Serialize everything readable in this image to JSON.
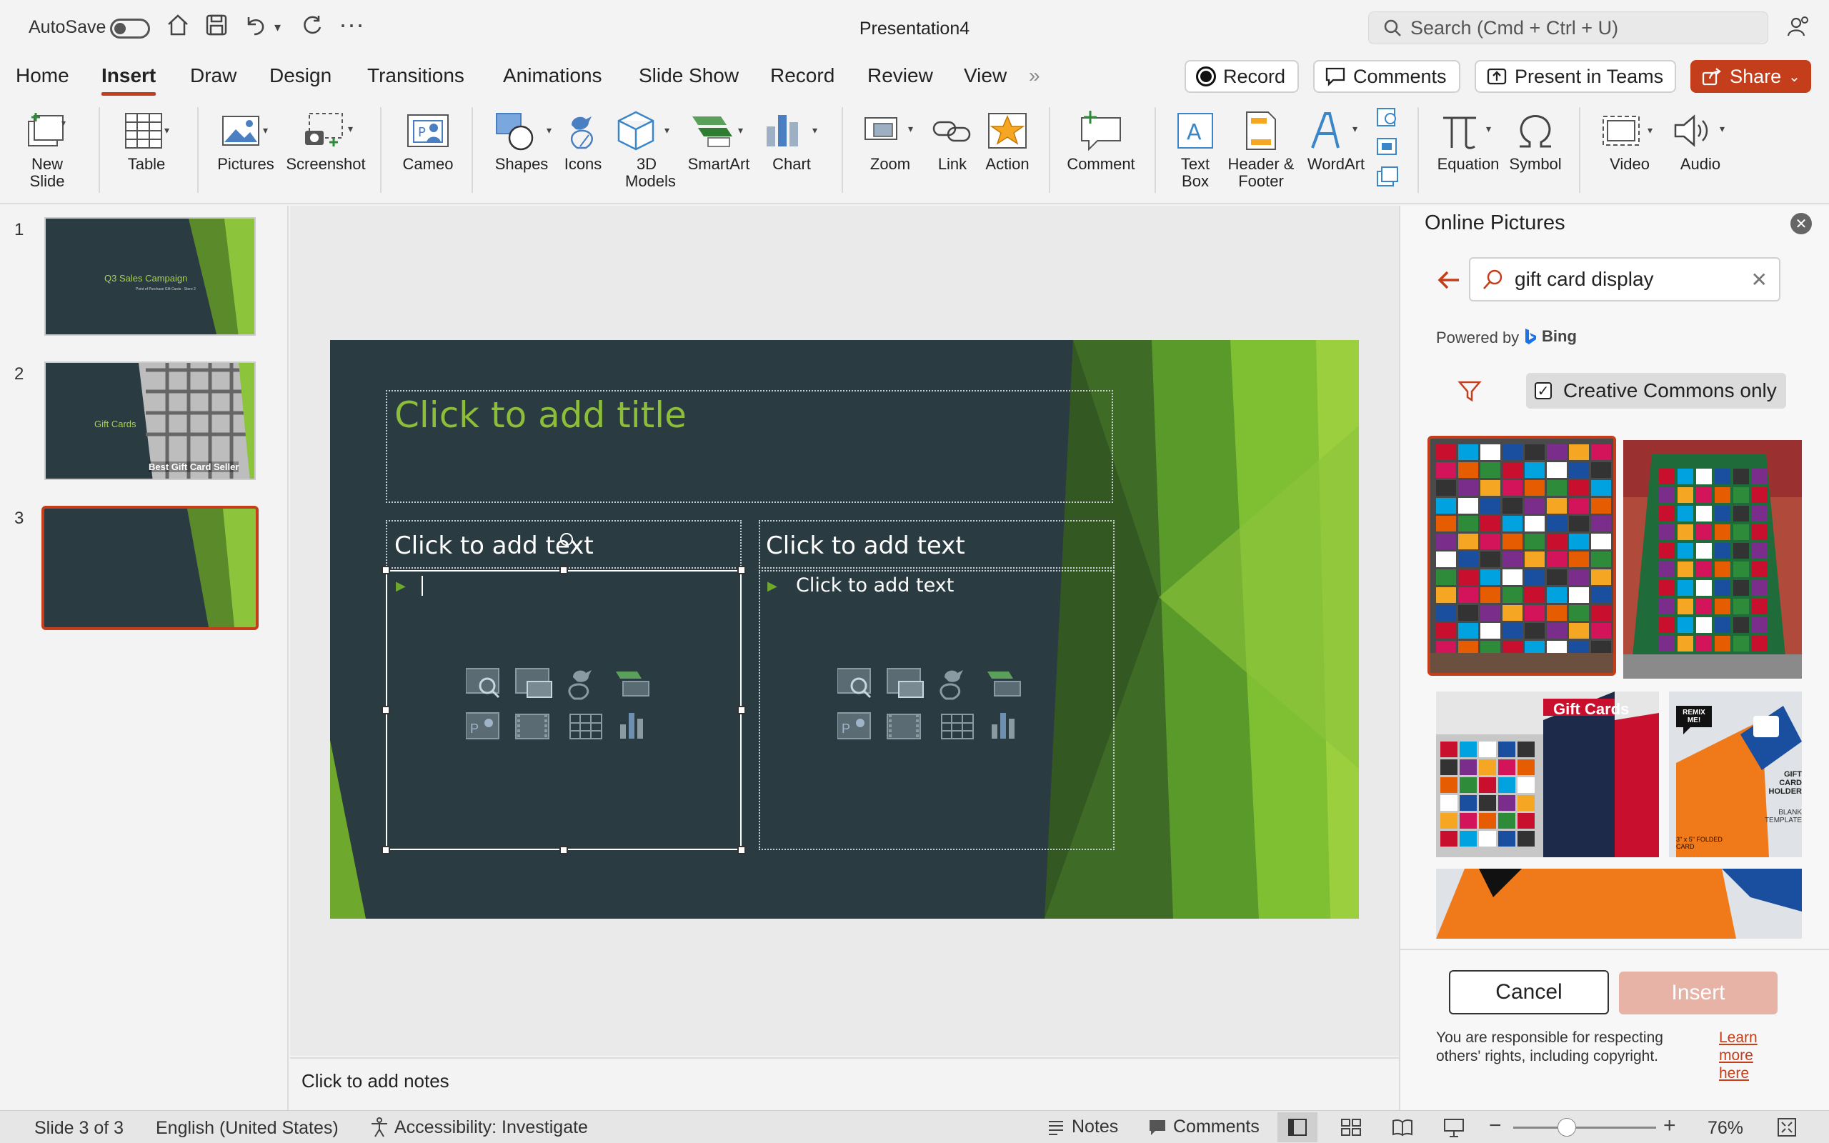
{
  "titlebar": {
    "autosave_label": "AutoSave",
    "doc_title": "Presentation4",
    "search_placeholder": "Search (Cmd + Ctrl + U)"
  },
  "menu": {
    "tabs": [
      "Home",
      "Insert",
      "Draw",
      "Design",
      "Transitions",
      "Animations",
      "Slide Show",
      "Record",
      "Review",
      "View"
    ],
    "active_tab": "Insert",
    "record_label": "Record",
    "comments_label": "Comments",
    "teams_label": "Present in Teams",
    "share_label": "Share"
  },
  "ribbon": {
    "new_slide": "New Slide",
    "table": "Table",
    "pictures": "Pictures",
    "screenshot": "Screenshot",
    "cameo": "Cameo",
    "shapes": "Shapes",
    "icons": "Icons",
    "models": "3D Models",
    "smartart": "SmartArt",
    "chart": "Chart",
    "zoom": "Zoom",
    "link": "Link",
    "action": "Action",
    "comment": "Comment",
    "textbox": "Text Box",
    "header_footer": "Header & Footer",
    "wordart": "WordArt",
    "equation": "Equation",
    "symbol": "Symbol",
    "video": "Video",
    "audio": "Audio"
  },
  "thumbnails": [
    {
      "num": "1",
      "title": "Q3 Sales Campaign",
      "subtitle": "Point of Purchase Gift Cards · Store 2"
    },
    {
      "num": "2",
      "title": "Gift Cards",
      "caption": "Best Gift Card Seller"
    },
    {
      "num": "3"
    }
  ],
  "slide": {
    "title_placeholder": "Click to add title",
    "left_header": "Click to add text",
    "right_header": "Click to add text",
    "right_bullet": "Click to add text"
  },
  "notes_placeholder": "Click to add notes",
  "pane": {
    "title": "Online Pictures",
    "search_value": "gift card display",
    "powered_by": "Powered by",
    "bing": "Bing",
    "cc_label": "Creative Commons only",
    "cc_checked": true,
    "cancel_label": "Cancel",
    "insert_label": "Insert",
    "disclaimer": "You are responsible for respecting others' rights, including copyright.",
    "learn_more": "Learn more here",
    "img3_sign": "Gift Cards",
    "img4_badge": "REMIX ME!",
    "img4_label": "GIFT CARD HOLDER",
    "img4_sub": "BLANK TEMPLATE",
    "img4_size": "3\" x 5\" FOLDED CARD"
  },
  "status": {
    "slide_counter": "Slide 3 of 3",
    "language": "English (United States)",
    "accessibility": "Accessibility: Investigate",
    "notes": "Notes",
    "comments": "Comments",
    "zoom": "76%"
  },
  "colors": {
    "accent": "#c43e1c",
    "slide_bg": "#2b3b42",
    "green": "#7ab829"
  }
}
